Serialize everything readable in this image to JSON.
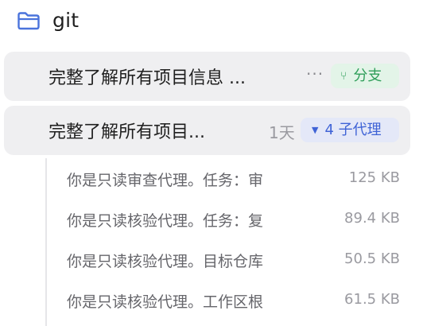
{
  "folder": {
    "name": "git",
    "icon": "folder-icon"
  },
  "sessions": [
    {
      "title": "完整了解所有项目信息 ...",
      "more_icon": "more-dots-icon",
      "more_label": "···",
      "badge": {
        "icon": "branch-icon",
        "glyph": "⑂",
        "label": "分支",
        "color": "#2f9e5a"
      }
    },
    {
      "title": "完整了解所有项目...",
      "age": "1天",
      "badge": {
        "icon": "caret-down-icon",
        "glyph": "▼",
        "label": "4 子代理",
        "color": "#3f63d6"
      },
      "children": [
        {
          "title": "你是只读审查代理。任务：审",
          "size": "125 KB"
        },
        {
          "title": "你是只读核验代理。任务：复",
          "size": "89.4 KB"
        },
        {
          "title": "你是只读核验代理。目标仓库",
          "size": "50.5 KB"
        },
        {
          "title": "你是只读核验代理。工作区根",
          "size": "61.5 KB"
        }
      ]
    }
  ]
}
